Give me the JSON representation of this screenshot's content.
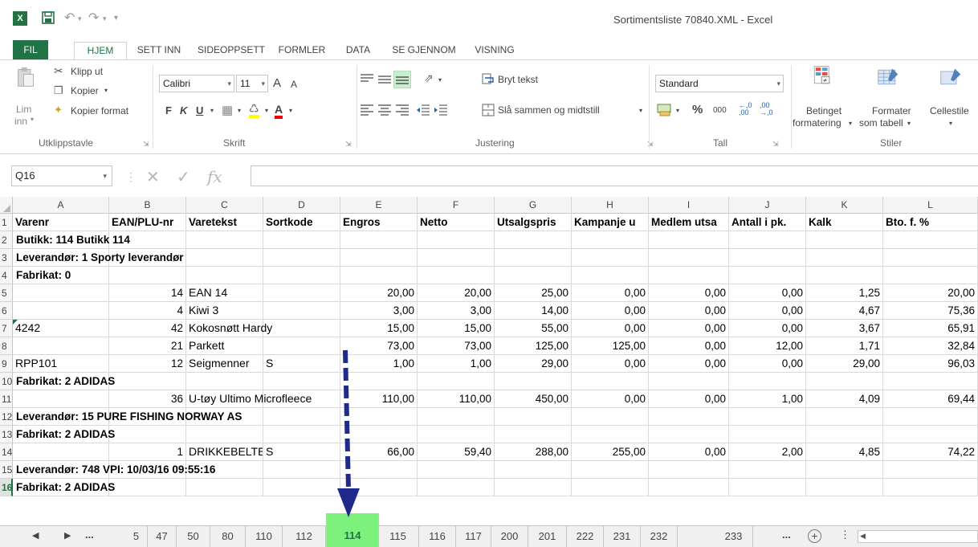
{
  "window": {
    "title": "Sortimentsliste 70840.XML - Excel"
  },
  "ribbon_tabs": [
    {
      "label": "FIL"
    },
    {
      "label": "HJEM"
    },
    {
      "label": "SETT INN"
    },
    {
      "label": "SIDEOPPSETT"
    },
    {
      "label": "FORMLER"
    },
    {
      "label": "DATA"
    },
    {
      "label": "SE GJENNOM"
    },
    {
      "label": "VISNING"
    }
  ],
  "clipboard": {
    "paste": "Lim",
    "paste2": "inn",
    "cut": "Klipp ut",
    "copy": "Kopier",
    "format_painter": "Kopier format",
    "group": "Utklippstavle"
  },
  "font": {
    "name": "Calibri",
    "size": "11",
    "bold": "F",
    "italic": "K",
    "underline": "U",
    "grow": "A",
    "shrink": "A",
    "color_letter": "A",
    "group": "Skrift"
  },
  "alignment": {
    "wrap": "Bryt tekst",
    "merge": "Slå sammen og midtstill",
    "group": "Justering"
  },
  "number": {
    "format": "Standard",
    "percent": "%",
    "thousands": "000",
    "inc_decimal": "←,0 ,00",
    "group": "Tall"
  },
  "styles": {
    "conditional": "Betinget",
    "conditional2": "formatering",
    "table": "Formater",
    "table2": "som tabell",
    "cell": "Cellestile",
    "group": "Stiler"
  },
  "formula_bar": {
    "name_box": "Q16",
    "fx": "fx",
    "formula": ""
  },
  "columns": [
    "A",
    "B",
    "C",
    "D",
    "E",
    "F",
    "G",
    "H",
    "I",
    "J",
    "K",
    "L"
  ],
  "rows": [
    {
      "n": "1",
      "cells": [
        "Varenr",
        "EAN/PLU-nr",
        "Varetekst",
        "Sortkode",
        "Engros",
        "Netto",
        "Utsalgspris",
        "Kampanje u",
        "Medlem utsa",
        "Antall i pk.",
        "Kalk",
        "Bto. f. %"
      ]
    },
    {
      "n": "2",
      "span": "Butikk: 114 Butikk 114"
    },
    {
      "n": "3",
      "span": "Leverandør: 1 Sporty leverandør"
    },
    {
      "n": "4",
      "span": "Fabrikat: 0"
    },
    {
      "n": "5",
      "cells": [
        "",
        "14",
        "EAN 14",
        "",
        "20,00",
        "20,00",
        "25,00",
        "0,00",
        "0,00",
        "0,00",
        "1,25",
        "20,00"
      ]
    },
    {
      "n": "6",
      "cells": [
        "",
        "4",
        "Kiwi 3",
        "",
        "3,00",
        "3,00",
        "14,00",
        "0,00",
        "0,00",
        "0,00",
        "4,67",
        "75,36"
      ]
    },
    {
      "n": "7",
      "cells": [
        "4242",
        "42",
        "Kokosnøtt Hardy",
        "",
        "15,00",
        "15,00",
        "55,00",
        "0,00",
        "0,00",
        "0,00",
        "3,67",
        "65,91"
      ]
    },
    {
      "n": "8",
      "cells": [
        "",
        "21",
        "Parkett",
        "",
        "73,00",
        "73,00",
        "125,00",
        "125,00",
        "0,00",
        "12,00",
        "1,71",
        "32,84"
      ]
    },
    {
      "n": "9",
      "cells": [
        "RPP101",
        "12",
        "Seigmenner",
        "S",
        "1,00",
        "1,00",
        "29,00",
        "0,00",
        "0,00",
        "0,00",
        "29,00",
        "96,03"
      ]
    },
    {
      "n": "10",
      "span": "Fabrikat: 2 ADIDAS"
    },
    {
      "n": "11",
      "cells": [
        "",
        "36",
        "U-tøy Ultimo Microfleece",
        "",
        "110,00",
        "110,00",
        "450,00",
        "0,00",
        "0,00",
        "1,00",
        "4,09",
        "69,44"
      ]
    },
    {
      "n": "12",
      "span": "Leverandør: 15 PURE FISHING NORWAY AS"
    },
    {
      "n": "13",
      "span": "Fabrikat: 2 ADIDAS"
    },
    {
      "n": "14",
      "cells": [
        "",
        "1",
        "DRIKKEBELTE",
        "S",
        "66,00",
        "59,40",
        "288,00",
        "255,00",
        "0,00",
        "2,00",
        "4,85",
        "74,22"
      ]
    },
    {
      "n": "15",
      "span": "Leverandør: 748 VPI: 10/03/16 09:55:16"
    },
    {
      "n": "16",
      "span": "Fabrikat: 2 ADIDAS"
    }
  ],
  "sheet_tabs": [
    "5",
    "47",
    "50",
    "80",
    "110",
    "112",
    "114",
    "115",
    "116",
    "117",
    "200",
    "201",
    "222",
    "231",
    "232",
    "233"
  ],
  "active_sheet": "114",
  "sheet_nav": {
    "ellipsis_left": "...",
    "ellipsis_right": "...",
    "add": "+"
  },
  "colors": {
    "excel_green": "#217346",
    "highlight_tab": "#7cf27c",
    "arrow": "#1f2a8c"
  }
}
